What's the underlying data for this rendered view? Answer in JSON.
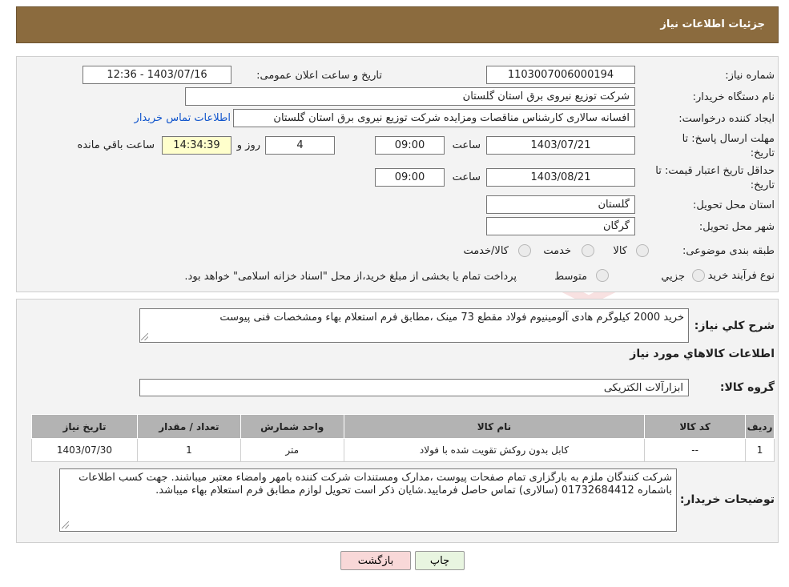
{
  "header": {
    "title": "جزئیات اطلاعات نیاز"
  },
  "watermark": {
    "text": "AriaTender.neT"
  },
  "form": {
    "need_number": {
      "label": "شماره نیاز:",
      "value": "1103007006000194"
    },
    "announce_datetime": {
      "label": "تاریخ و ساعت اعلان عمومی:",
      "value": "1403/07/16 - 12:36"
    },
    "buyer_org": {
      "label": "نام دستگاه خریدار:",
      "value": "شرکت توزیع نیروی برق استان گلستان"
    },
    "requester": {
      "label": "ایجاد کننده درخواست:",
      "value": "افسانه سالاری کارشناس مناقصات ومزایده شرکت توزیع نیروی برق استان گلستان",
      "contact_link": "اطلاعات تماس خریدار"
    },
    "reply_deadline": {
      "label_line1": "مهلت ارسال پاسخ: تا",
      "label_line2": "تاریخ:",
      "date": "1403/07/21",
      "time_label": "ساعت",
      "time": "09:00",
      "days": "4",
      "days_label": "روز و",
      "remaining": "14:34:39",
      "remaining_label": "ساعت باقي مانده"
    },
    "price_validity": {
      "label_line1": "حداقل تاریخ اعتبار قیمت: تا",
      "label_line2": "تاریخ:",
      "date": "1403/08/21",
      "time_label": "ساعت",
      "time": "09:00"
    },
    "delivery_province": {
      "label": "استان محل تحویل:",
      "value": "گلستان"
    },
    "delivery_city": {
      "label": "شهر محل تحویل:",
      "value": "گرگان"
    },
    "category": {
      "label": "طبقه بندی موضوعی:",
      "options": [
        "کالا",
        "خدمت",
        "کالا/خدمت"
      ]
    },
    "purchase_type": {
      "label": "نوع فرآیند خرید :",
      "options": [
        "جزیي",
        "متوسط"
      ],
      "note": "پرداخت تمام یا بخشی از مبلغ خرید،از محل \"اسناد خزانه اسلامی\" خواهد بود."
    }
  },
  "summary": {
    "label": "شرح كلي نياز:",
    "value": "خرید 2000 کیلوگرم هادی آلومینیوم فولاد مقطع 73 مینک ،مطابق فرم استعلام بهاء ومشخصات فنی پیوست"
  },
  "goods_section": {
    "title": "اطلاعات كالاهاي مورد نياز"
  },
  "goods_group": {
    "label": "گروه کالا:",
    "value": "ابزارآلات الکتریکی"
  },
  "table": {
    "headers": [
      "ردیف",
      "کد کالا",
      "نام کالا",
      "واحد شمارش",
      "تعداد / مقدار",
      "تاریخ نیاز"
    ],
    "rows": [
      [
        "1",
        "--",
        "کابل بدون روکش تقویت شده با فولاد",
        "متر",
        "1",
        "1403/07/30"
      ]
    ]
  },
  "buyer_notes": {
    "label": "توضیحات خریدار:",
    "value": "شرکت کنندگان ملزم به بارگزاری تمام صفحات پیوست ،مدارک ومستندات شرکت کننده بامهر وامضاء معتبر میباشند. جهت کسب اطلاعات باشماره 01732684412 (سالاری) تماس حاصل فرمایید.شایان ذکر است تحویل لوازم مطابق فرم استعلام بهاء میباشد."
  },
  "buttons": {
    "print": "چاپ",
    "back": "بازگشت"
  },
  "colors": {
    "header_bg": "#8b6b3e",
    "back_btn_bg": "#f8d8d8",
    "print_btn_bg": "#e8f5e0"
  }
}
